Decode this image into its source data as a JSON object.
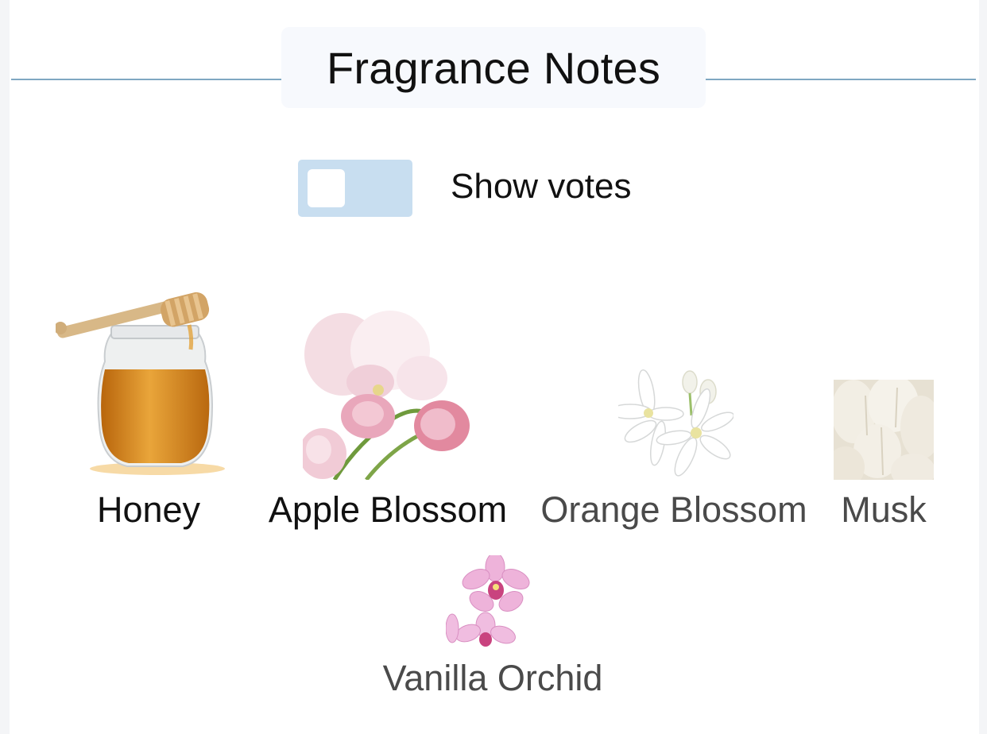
{
  "section": {
    "title": "Fragrance Notes"
  },
  "votes_toggle": {
    "label": "Show votes",
    "on": false
  },
  "notes": [
    {
      "name": "Honey",
      "icon": "honey-jar-photo"
    },
    {
      "name": "Apple Blossom",
      "icon": "apple-blossom-photo"
    },
    {
      "name": "Orange Blossom",
      "icon": "orange-blossom-photo"
    },
    {
      "name": "Musk",
      "icon": "musk-photo"
    },
    {
      "name": "Vanilla Orchid",
      "icon": "vanilla-orchid-photo"
    }
  ],
  "colors": {
    "rule": "#7fa7c2",
    "toggle_track": "#c8def0",
    "title_bg": "#f7f9fd",
    "label_dark": "#111111",
    "label_grey": "#4a4a4a"
  }
}
